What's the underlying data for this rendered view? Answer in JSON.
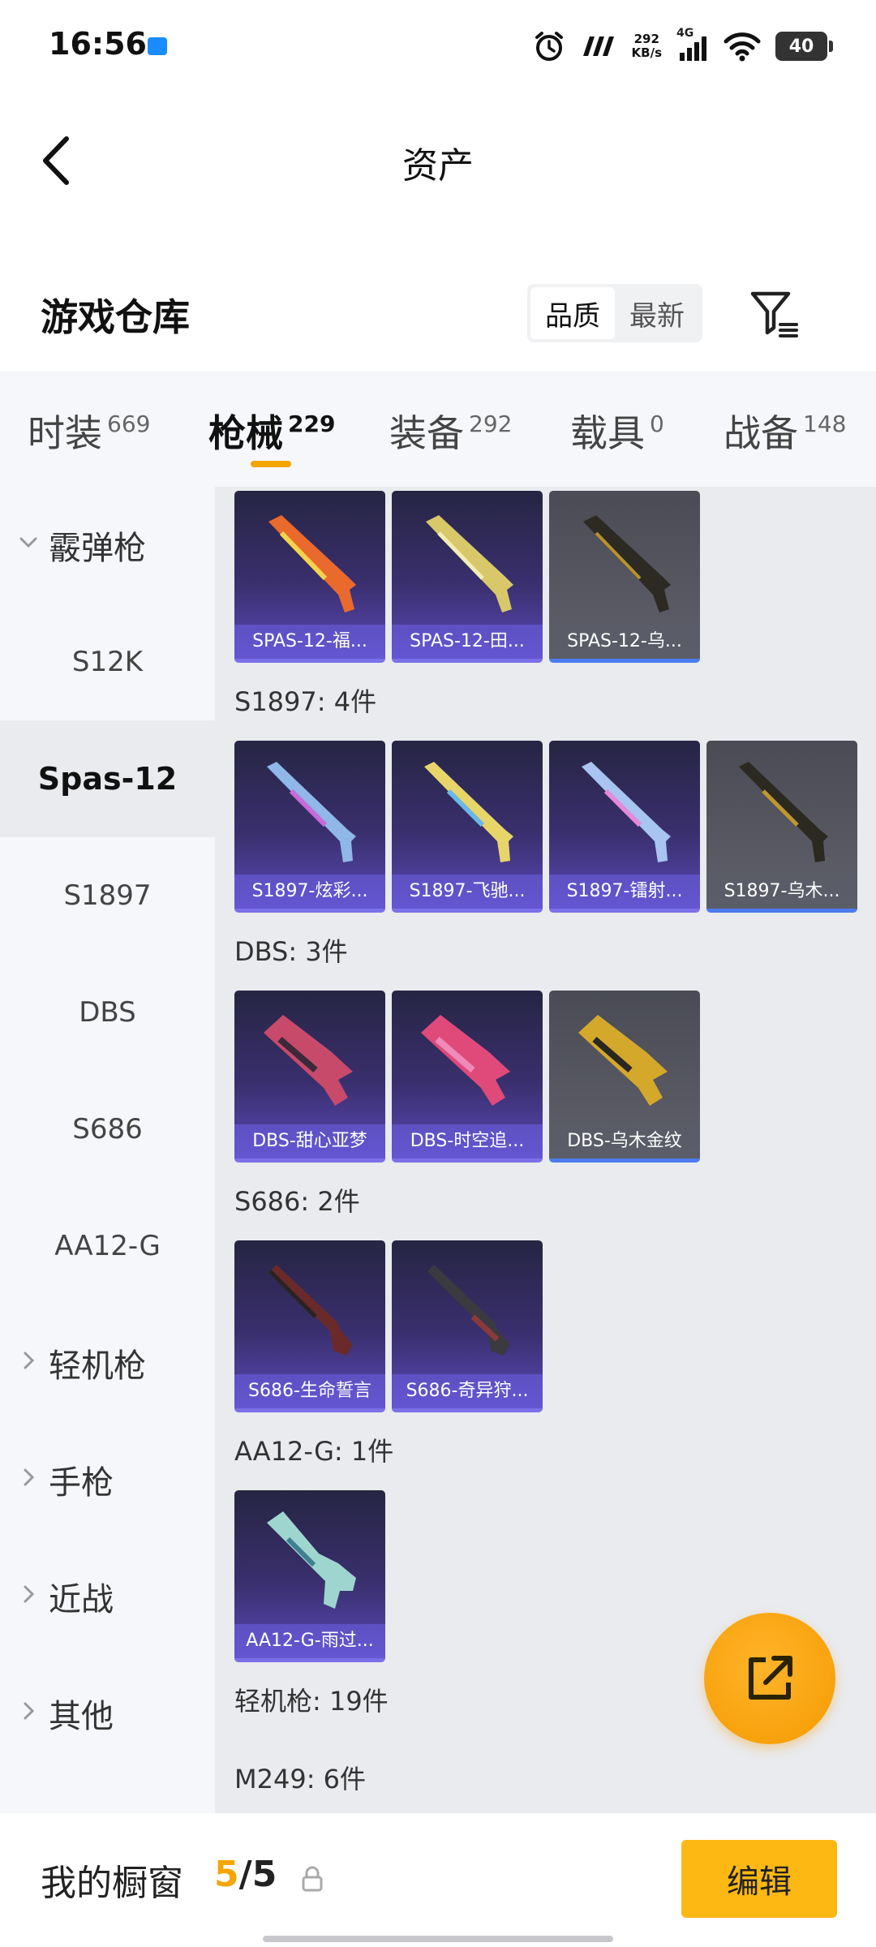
{
  "status_bar": {
    "time": "16:56",
    "net_speed_value": "292",
    "net_speed_unit": "KB/s",
    "network_type": "4G",
    "battery": "40",
    "icons": [
      "app-notification-icon",
      "alarm-icon",
      "carrier-logo-icon",
      "signal-icon",
      "wifi-icon",
      "battery-icon"
    ]
  },
  "header": {
    "title": "资产",
    "back_icon": "chevron-left-icon"
  },
  "warehouse": {
    "title": "游戏仓库",
    "sort_options": [
      "品质",
      "最新"
    ],
    "sort_selected": "品质",
    "filter_icon": "filter-icon"
  },
  "tabs": [
    {
      "label": "时装",
      "count": "669"
    },
    {
      "label": "枪械",
      "count": "229",
      "active": true
    },
    {
      "label": "装备",
      "count": "292"
    },
    {
      "label": "载具",
      "count": "0"
    },
    {
      "label": "战备",
      "count": "148"
    }
  ],
  "sidebar": {
    "items": [
      {
        "label": "霰弹枪",
        "type": "group-expanded"
      },
      {
        "label": "S12K"
      },
      {
        "label": "Spas-12",
        "active": true
      },
      {
        "label": "S1897"
      },
      {
        "label": "DBS"
      },
      {
        "label": "S686"
      },
      {
        "label": "AA12-G"
      },
      {
        "label": "轻机枪",
        "type": "group-collapsed"
      },
      {
        "label": "手枪",
        "type": "group-collapsed"
      },
      {
        "label": "近战",
        "type": "group-collapsed"
      },
      {
        "label": "其他",
        "type": "group-collapsed"
      }
    ]
  },
  "content": {
    "spas_cards": [
      "SPAS-12-福...",
      "SPAS-12-田...",
      "SPAS-12-乌..."
    ],
    "s1897_title": "S1897: 4件",
    "s1897_cards": [
      "S1897-炫彩...",
      "S1897-飞驰...",
      "S1897-镭射...",
      "S1897-乌木..."
    ],
    "dbs_title": "DBS: 3件",
    "dbs_cards": [
      "DBS-甜心亚梦",
      "DBS-时空追...",
      "DBS-乌木金纹"
    ],
    "s686_title": "S686: 2件",
    "s686_cards": [
      "S686-生命誓言",
      "S686-奇异狩..."
    ],
    "aa12_title": "AA12-G: 1件",
    "aa12_cards": [
      "AA12-G-雨过..."
    ],
    "lmg_title": "轻机枪: 19件",
    "m249_title": "M249: 6件"
  },
  "fab": {
    "icon": "share-export-icon"
  },
  "bottom_bar": {
    "label": "我的橱窗",
    "current": "5",
    "separator": "/",
    "total": "5",
    "lock_icon": "lock-icon",
    "edit_label": "编辑"
  },
  "colors": {
    "accent": "#f5a500",
    "edit_button": "#fdb813",
    "card_purple": "#5a49b8",
    "card_gray": "#5f6069"
  }
}
